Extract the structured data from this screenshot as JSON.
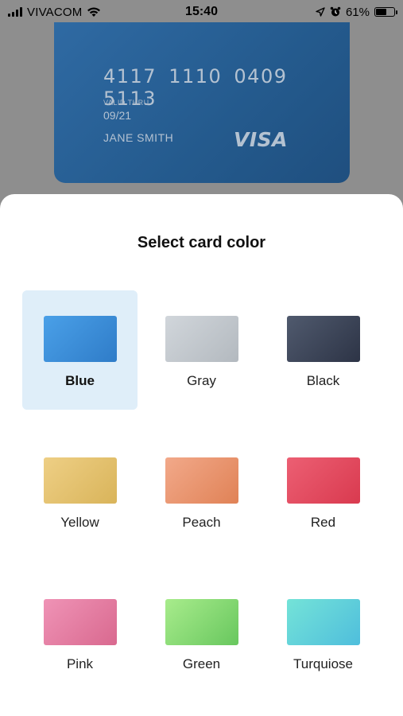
{
  "status_bar": {
    "carrier": "VIVACOM",
    "time": "15:40",
    "battery_percent": "61%",
    "battery_level": 0.61,
    "icons": [
      "signal-icon",
      "wifi-icon",
      "location-icon",
      "alarm-icon",
      "battery-icon"
    ]
  },
  "card": {
    "number": "4117 1110 0409 5113",
    "valid_label": "VALID THRU",
    "valid_value": "09/21",
    "holder": "JANE SMITH",
    "brand": "VISA"
  },
  "sheet": {
    "title": "Select card color",
    "selected": "Blue",
    "options": [
      {
        "label": "Blue",
        "colors": [
          "#4aa0e8",
          "#2f7cc8"
        ]
      },
      {
        "label": "Gray",
        "colors": [
          "#d1d6db",
          "#b3b9bf"
        ]
      },
      {
        "label": "Black",
        "colors": [
          "#505a6e",
          "#2d3446"
        ]
      },
      {
        "label": "Yellow",
        "colors": [
          "#eecf85",
          "#d9b45a"
        ]
      },
      {
        "label": "Peach",
        "colors": [
          "#f2a98a",
          "#e08256"
        ]
      },
      {
        "label": "Red",
        "colors": [
          "#ec5f73",
          "#d93a4f"
        ]
      },
      {
        "label": "Pink",
        "colors": [
          "#ef93b6",
          "#d9698f"
        ]
      },
      {
        "label": "Green",
        "colors": [
          "#a8ec8c",
          "#68c75e"
        ]
      },
      {
        "label": "Turquiose",
        "colors": [
          "#74e3d8",
          "#4fbedc"
        ]
      }
    ]
  }
}
